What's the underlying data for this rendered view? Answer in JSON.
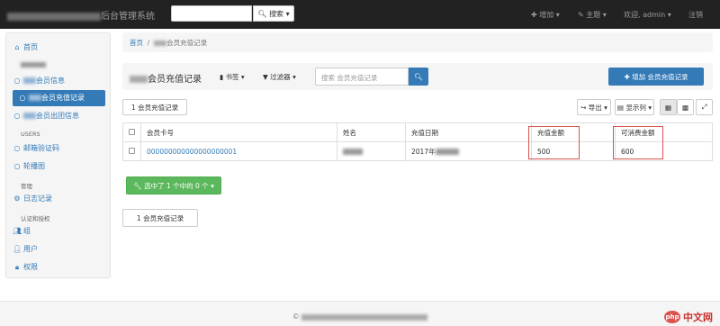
{
  "navbar": {
    "title_suffix": "后台管理系统",
    "search_button": "搜索",
    "add_menu": "增加",
    "theme_menu": "主题",
    "welcome": "欢迎, admin",
    "logout": "注销"
  },
  "sidebar": {
    "home": "首页",
    "items": [
      "会员信息",
      "会员充值记录",
      "会员出团信息"
    ],
    "section_users": "USERS",
    "users_items": [
      "邮箱验证码",
      "轮播图"
    ],
    "section_manage": "管理",
    "manage_items": [
      "日志记录"
    ],
    "section_auth": "认证和授权",
    "auth_items": [
      "组",
      "用户",
      "权限"
    ]
  },
  "breadcrumb": {
    "home": "首页",
    "sep": "/",
    "current": "会员充值记录"
  },
  "header": {
    "title": "会员充值记录",
    "bookmark": "书签",
    "filter": "过滤器",
    "search_placeholder": "搜索 会员充值记录",
    "add_button": "增加 会员充值记录"
  },
  "toolbar": {
    "count_label": "1 会员充值记录",
    "export": "导出",
    "columns": "显示列"
  },
  "table": {
    "headers": [
      "会员卡号",
      "姓名",
      "充值日期",
      "充值金额",
      "可消费金额"
    ],
    "rows": [
      {
        "card": "000000000000000000001",
        "name": "",
        "date": "2017年",
        "amount": "500",
        "spendable": "600"
      }
    ]
  },
  "action_button": "选中了 1 个中的 0 个",
  "bottom_count": "1 会员充值记录",
  "footer": {
    "copyright": "©"
  },
  "watermark": {
    "logo": "php",
    "text": "中文网"
  }
}
